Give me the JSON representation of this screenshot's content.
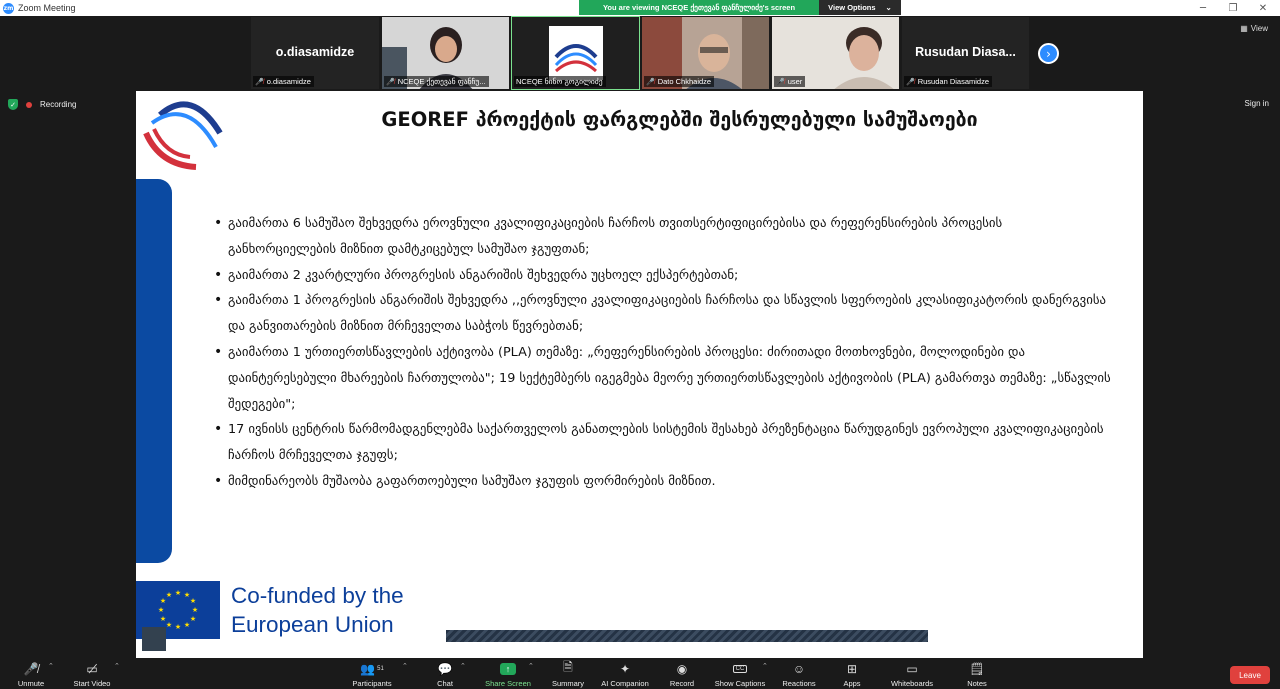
{
  "window": {
    "title": "Zoom Meeting"
  },
  "banner": {
    "message": "You are viewing NCEQE ქეთევან ფანჩულიძე's screen",
    "options_label": "View Options"
  },
  "gallery": {
    "view_label": "View",
    "tiles": [
      {
        "big_name": "o.diasamidze",
        "label": "o.diasamidze"
      },
      {
        "label": "NCEQE ქეთევან ფანჩუ..."
      },
      {
        "label": "NCEQE ნინო გოგილიძე"
      },
      {
        "label": "Dato Chkhaidze"
      },
      {
        "label": "user"
      },
      {
        "big_name": "Rusudan  Diasa...",
        "label": "Rusudan Diasamidze"
      }
    ]
  },
  "status": {
    "recording": "Recording",
    "sign_in": "Sign in"
  },
  "slide": {
    "title": "GEOREF პროექტის ფარგლებში შესრულებული სამუშაოები",
    "bullets": [
      "გაიმართა 6 სამუშაო შეხვედრა  ეროვნული კვალიფიკაციების ჩარჩოს თვითსერტიფიცირებისა და რეფერენსირების პროცესის განხორციელების მიზნით დამტკიცებულ სამუშაო ჯგუფთან;",
      "გაიმართა 2 კვარტლური პროგრესის ანგარიშის შეხვედრა უცხოელ ექსპერტებთან;",
      "გაიმართა 1 პროგრესის ანგარიშის შეხვედრა ,,ეროვნული კვალიფიკაციების ჩარჩოსა და სწავლის სფეროების კლასიფიკატორის დანერგვისა და განვითარების მიზნით მრჩეველთა საბჭოს წევრებთან;",
      "გაიმართა 1 ურთიერთსწავლების აქტივობა  (PLA) თემაზე: „რეფერენსირების პროცესი: ძირითადი მოთხოვნები, მოლოდინები და დაინტერესებული მხარეების ჩართულობა\"; 19 სექტემბერს იგეგმება მეორე ურთიერთსწავლების აქტივობის (PLA) გამართვა თემაზე: „სწავლის შედეგები\";",
      "17 ივნისს ცენტრის წარმომადგენლებმა საქართველოს განათლების სისტემის შესახებ პრეზენტაცია წარუდგინეს ევროპული კვალიფიკაციების ჩარჩოს მრჩეველთა ჯგუფს;",
      "მიმდინარეობს მუშაობა გაფართოებული სამუშაო ჯგუფის ფორმირების მიზნით."
    ],
    "eu_line1": "Co-funded by the",
    "eu_line2": "European Union"
  },
  "toolbar": {
    "unmute": "Unmute",
    "start_video": "Start Video",
    "participants": "Participants",
    "participants_count": "51",
    "chat": "Chat",
    "share_screen": "Share Screen",
    "summary": "Summary",
    "ai_companion": "AI Companion",
    "record": "Record",
    "show_captions": "Show Captions",
    "reactions": "Reactions",
    "apps": "Apps",
    "whiteboards": "Whiteboards",
    "notes": "Notes",
    "leave": "Leave",
    "captions_icon_text": "CC"
  },
  "colors": {
    "accent": "#2d8cff",
    "share_green": "#22a75a",
    "leave_red": "#e0413d",
    "slide_blue": "#0b4aa2"
  }
}
